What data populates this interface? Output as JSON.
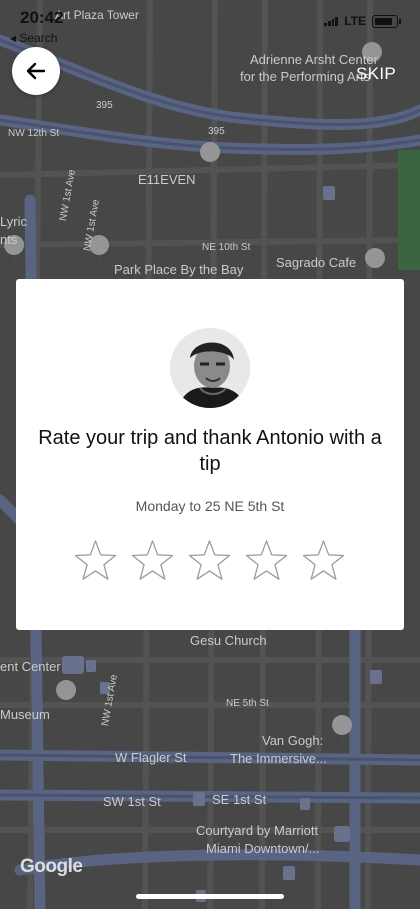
{
  "status_bar": {
    "time": "20:42",
    "back_label": "◂ Search",
    "network": "LTE"
  },
  "header": {
    "skip_label": "SKIP"
  },
  "map": {
    "labels": {
      "art_plaza": "Art Plaza Tower",
      "arsht": "Adrienne Arsht Center",
      "arsht2": "for the Performing Arts",
      "hw395a": "395",
      "hw395b": "395",
      "nw12": "NW 12th St",
      "e11even": "E11EVEN",
      "lyric1": "Lyric",
      "lyric2": "nts",
      "nw1ave_a": "NW 1st Ave",
      "nw1ave_b": "NW 1st Ave",
      "ne10": "NE 10th St",
      "parkplace": "Park Place By the Bay",
      "sagrado": "Sagrado Cafe",
      "gesu": "Gesu Church",
      "center": "ent Center",
      "nw1ave_c": "NW 1st Ave",
      "museum": "Museum",
      "ne5": "NE 5th St",
      "vangogh1": "Van Gogh:",
      "vangogh2": "The Immersive...",
      "flagler": "W Flagler St",
      "sw1": "SW 1st St",
      "se1": "SE 1st St",
      "courtyard1": "Courtyard by Marriott",
      "courtyard2": "Miami Downtown/..."
    },
    "attribution": "Google"
  },
  "rating_card": {
    "title": "Rate your trip and thank Antonio with a tip",
    "trip_info": "Monday to 25 NE 5th St",
    "star_count": 5,
    "selected_rating": 0
  },
  "colors": {
    "map_bg": "#4d4d4d",
    "road": "#5f6b86",
    "card_bg": "#ffffff",
    "star_outline": "#9a9a9a"
  }
}
